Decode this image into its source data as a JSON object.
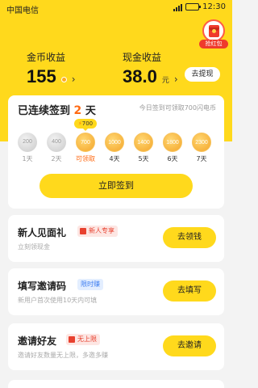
{
  "status_bar": {
    "carrier": "中国电信",
    "time": "12:30"
  },
  "header": {
    "red_packet_label": "抢红包",
    "coin_income": {
      "label": "金币收益",
      "value": "155"
    },
    "cash_income": {
      "label": "现金收益",
      "value": "38.0",
      "unit": "元",
      "button": "去提现"
    }
  },
  "signin": {
    "title_prefix": "已连续签到",
    "days": "2",
    "title_suffix": "天",
    "hint": "今日签到可领取700闪电币",
    "bubble": "700",
    "items": [
      {
        "value": "200",
        "label": "1天",
        "state": "done"
      },
      {
        "value": "400",
        "label": "2天",
        "state": "done"
      },
      {
        "value": "700",
        "label": "可领取",
        "state": "today"
      },
      {
        "value": "1000",
        "label": "4天",
        "state": "future"
      },
      {
        "value": "1400",
        "label": "5天",
        "state": "future"
      },
      {
        "value": "1800",
        "label": "6天",
        "state": "future"
      },
      {
        "value": "2300",
        "label": "7天",
        "state": "future"
      }
    ],
    "button": "立即签到"
  },
  "tasks": [
    {
      "title": "新人见面礼",
      "tag": "新人专享",
      "subtitle": "立刻领现金",
      "button": "去领钱"
    },
    {
      "title": "填写邀请码",
      "tag": "限时赚",
      "subtitle": "新用户首次使用10天内可填",
      "button": "去填写"
    },
    {
      "title": "邀请好友",
      "tag": "无上限",
      "subtitle": "邀请好友数量无上限，多邀多赚",
      "button": "去邀请"
    }
  ]
}
